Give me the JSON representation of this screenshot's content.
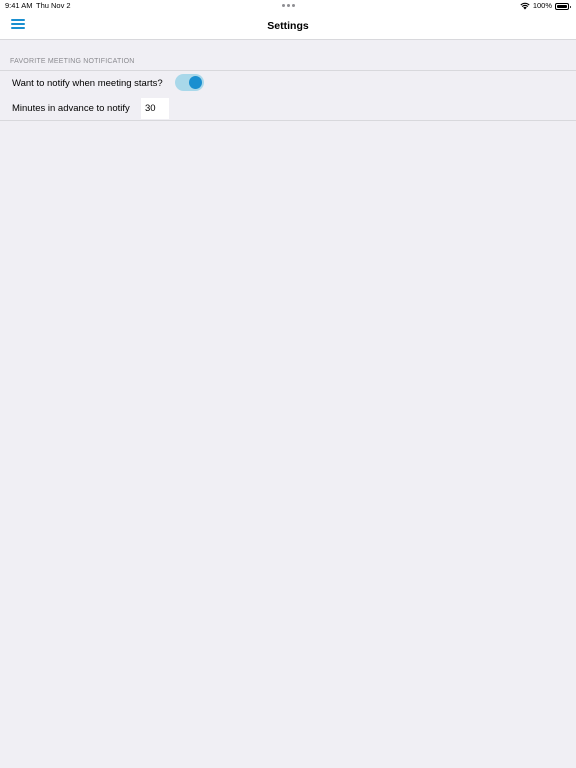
{
  "status_bar": {
    "time": "9:41 AM",
    "date": "Thu Nov 2",
    "battery": "100%",
    "wifi_icon": "wifi-icon",
    "battery_icon": "battery-icon"
  },
  "nav": {
    "title": "Settings",
    "menu_icon": "hamburger-menu-icon"
  },
  "section": {
    "header": "FAVORITE MEETING NOTIFICATION",
    "rows": [
      {
        "label": "Want to notify when meeting starts?",
        "toggle_on": true
      },
      {
        "label": "Minutes in advance to notify",
        "value": "30"
      }
    ]
  },
  "colors": {
    "accent": "#1a8fd0",
    "toggle_track": "#a9d8ea",
    "background": "#f0eff4",
    "header_text": "#8a8a8f"
  }
}
